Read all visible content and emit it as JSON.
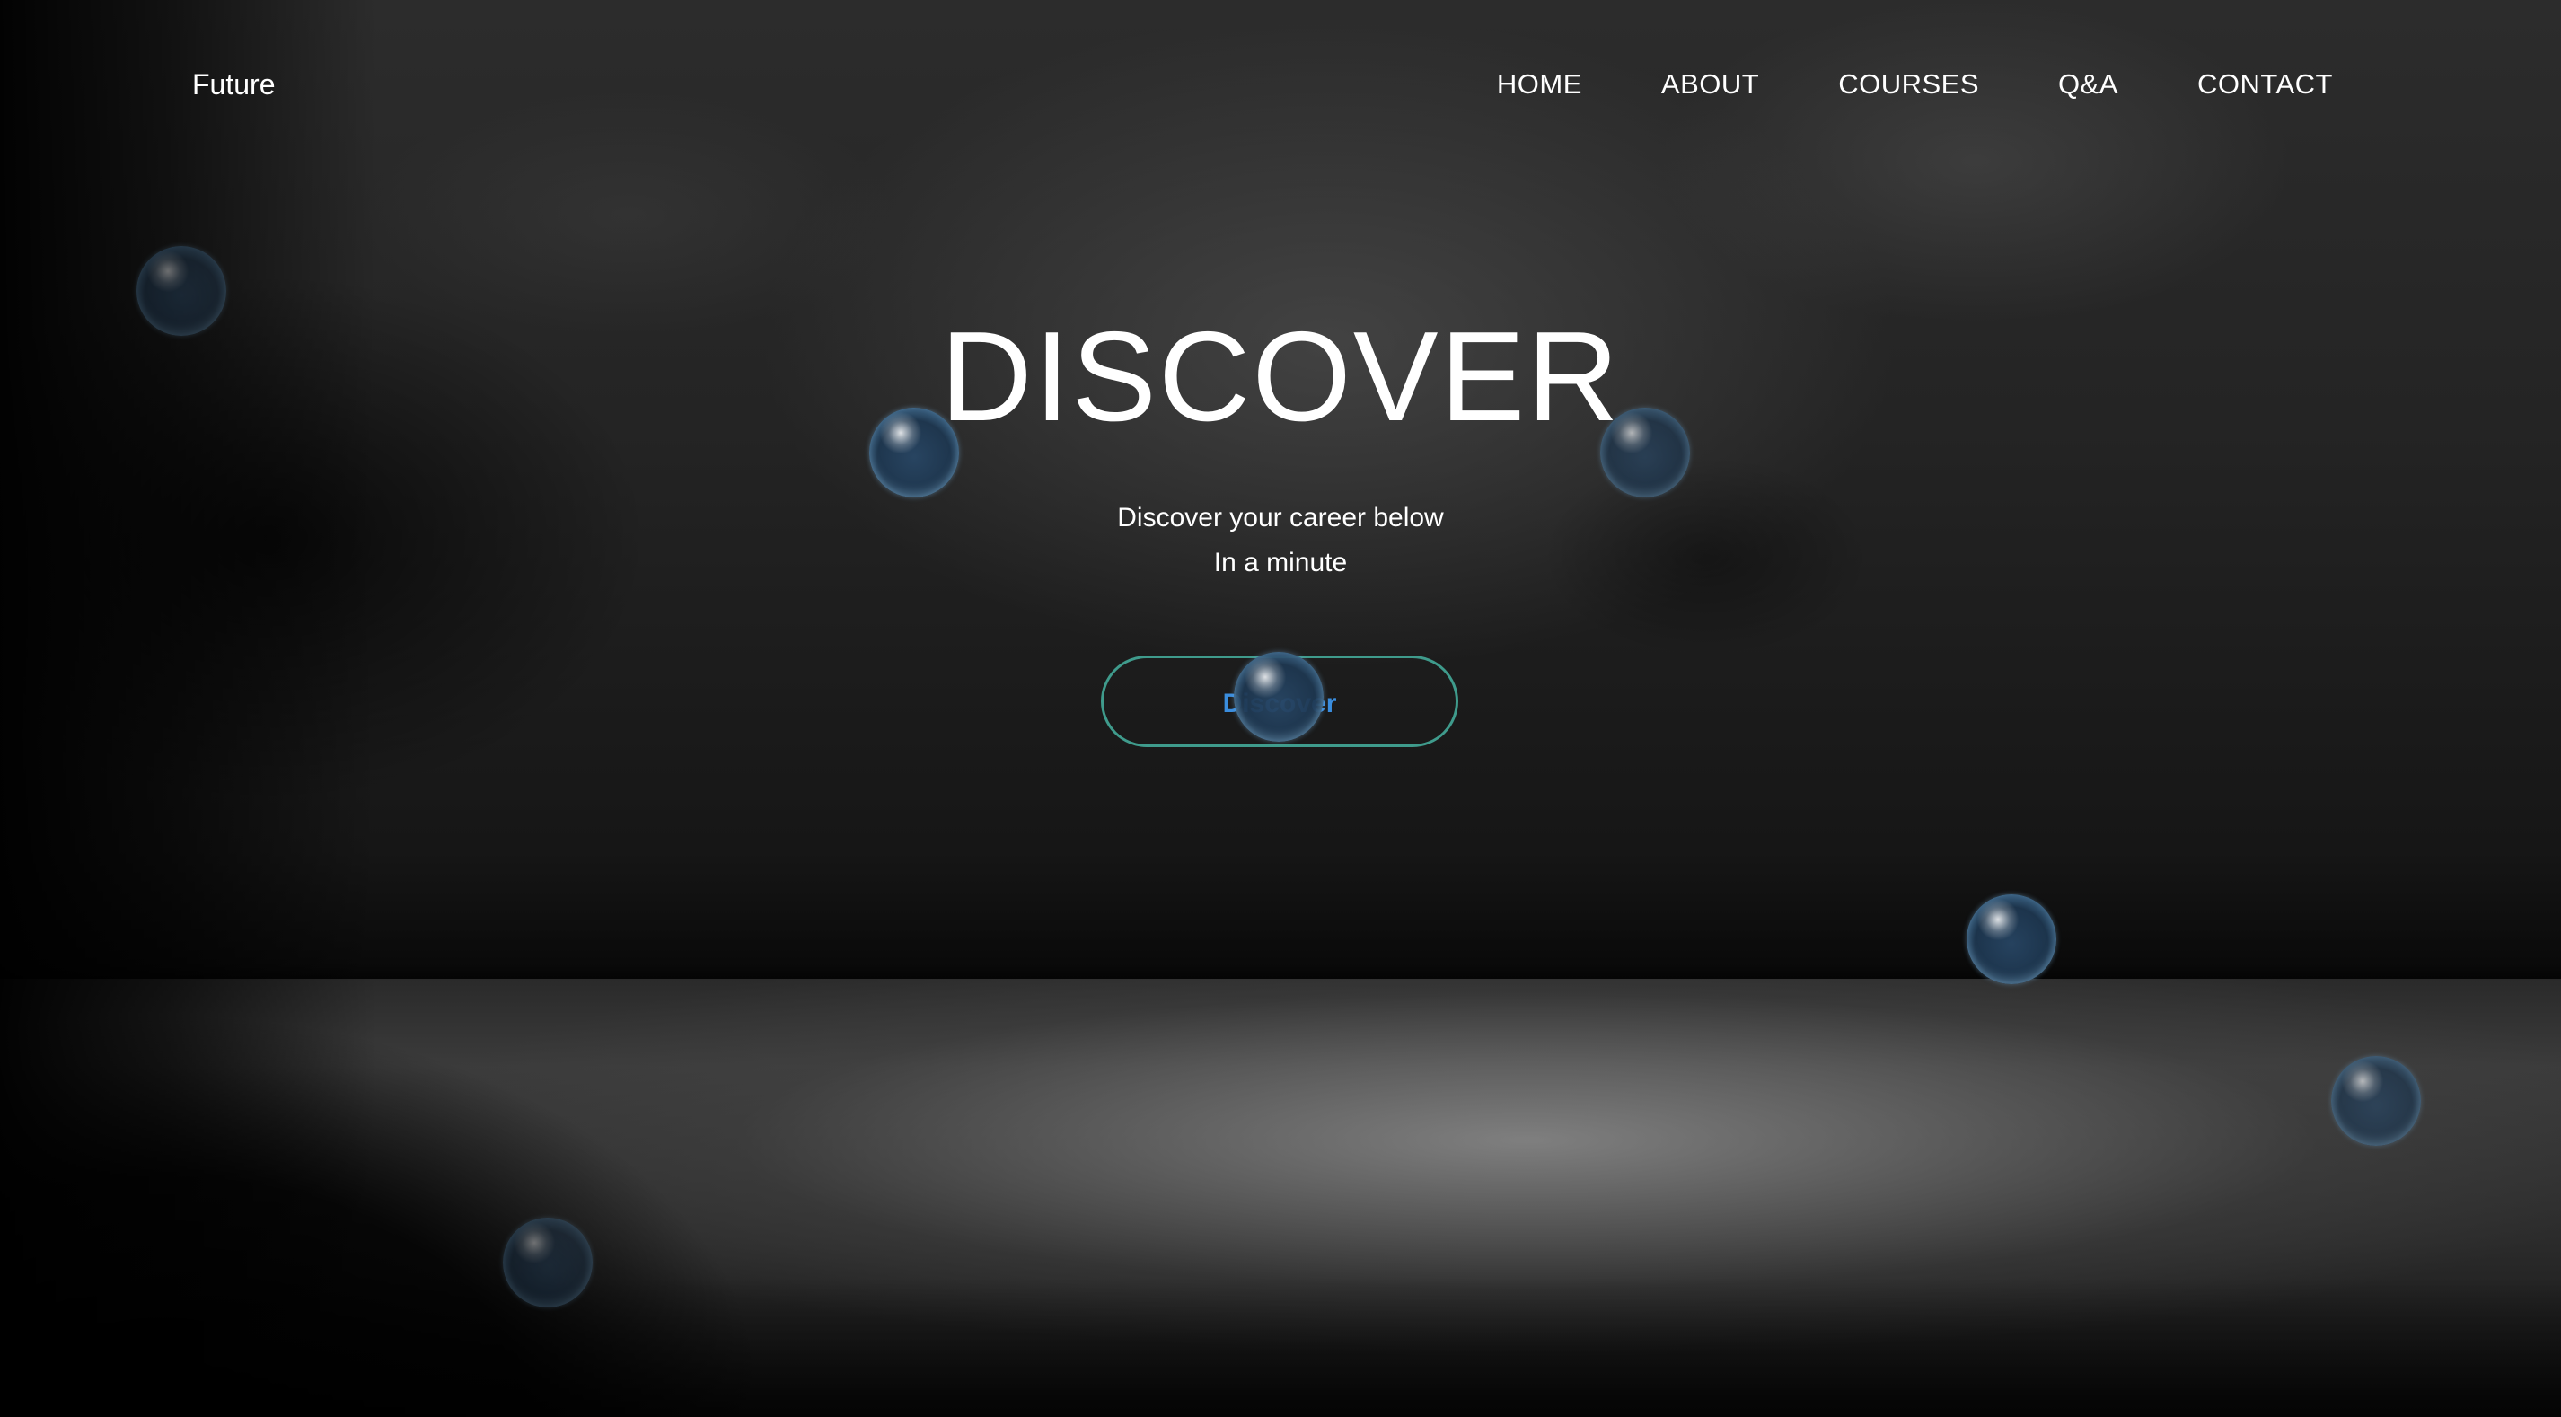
{
  "logo": {
    "label": "Future"
  },
  "nav": {
    "links": [
      {
        "label": "HOME"
      },
      {
        "label": "ABOUT"
      },
      {
        "label": "COURSES"
      },
      {
        "label": "Q&A"
      },
      {
        "label": "CONTACT"
      }
    ]
  },
  "hero": {
    "title": "DISCOVER",
    "subtitle_line1": "Discover your career below",
    "subtitle_line2": "In a minute",
    "cta_label": "Discover"
  },
  "colors": {
    "cta_border": "#3f9b8c",
    "cta_text": "#3a8dde",
    "text": "#ffffff",
    "background": "#000000"
  },
  "decor": {
    "bubble_icon": "bubble-icon"
  }
}
